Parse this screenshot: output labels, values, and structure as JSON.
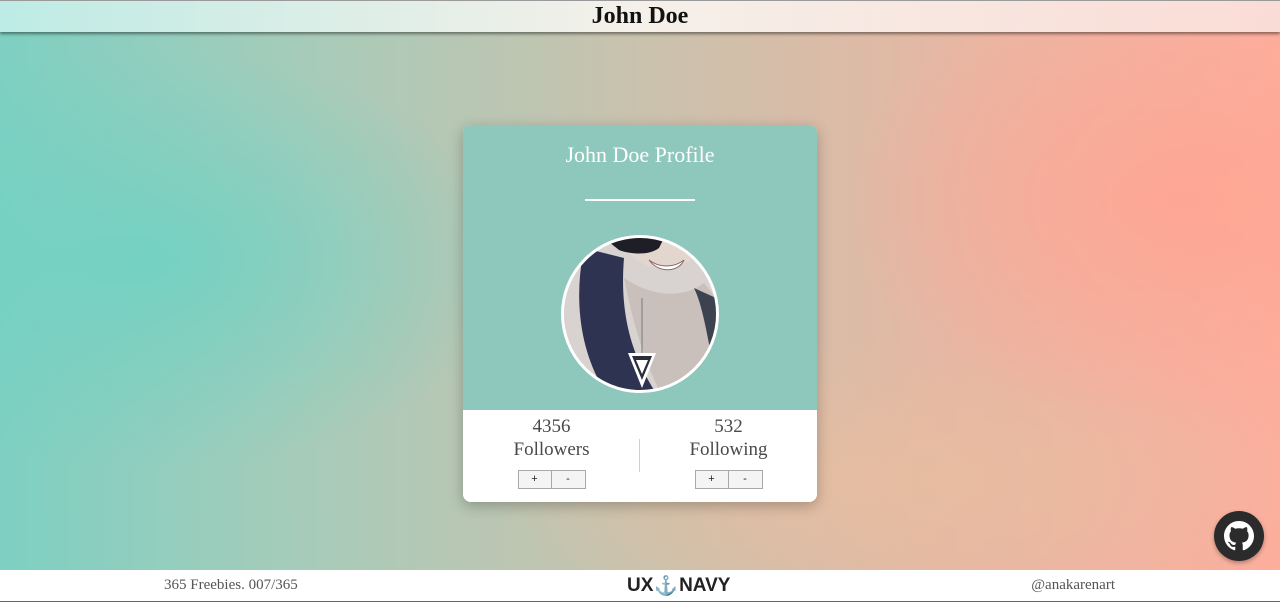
{
  "header": {
    "title": "John Doe"
  },
  "card": {
    "title": "John Doe Profile",
    "followers": {
      "count": "4356",
      "label": "Followers",
      "plus": "+",
      "minus": "-"
    },
    "following": {
      "count": "532",
      "label": "Following",
      "plus": "+",
      "minus": "-"
    }
  },
  "footer": {
    "left_text": "365 Freebies. 007/365",
    "logo_left": "UX",
    "logo_anchor": "⚓",
    "logo_right": "NAVY",
    "right_text": "@anakarenart"
  },
  "icons": {
    "fab": "github-icon"
  },
  "colors": {
    "card_top": "#8ec8bc",
    "accent_anchor": "#d8313a",
    "fab": "#2b2b2b"
  }
}
